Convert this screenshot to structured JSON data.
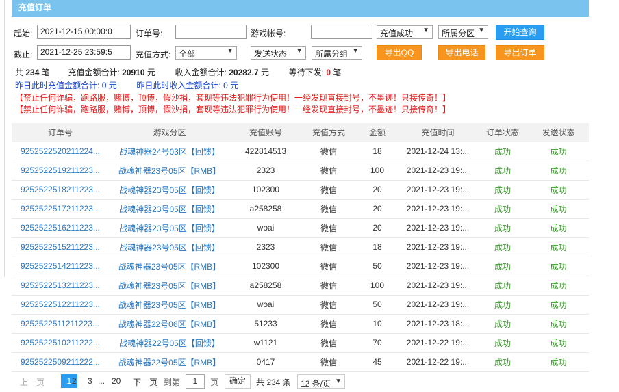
{
  "title": "充值订单",
  "filters": {
    "start_label": "起始:",
    "start_value": "2021-12-15 00:00:0",
    "order_label": "订单号:",
    "order_value": "",
    "account_label": "游戏帐号:",
    "account_value": "",
    "status_select": "充值成功",
    "zone_select": "所属分区",
    "query_btn": "开始查询",
    "end_label": "截止:",
    "end_value": "2021-12-25 23:59:5",
    "method_label": "充值方式:",
    "method_select": "全部",
    "send_select": "发送状态",
    "group_select": "所属分组",
    "export_qq": "导出QQ",
    "export_phone": "导出电话",
    "export_order": "导出订单"
  },
  "summary": {
    "total_prefix": "共",
    "total_count": "234",
    "total_suffix": "笔",
    "recharge_label": "充值金额合计:",
    "recharge_value": "20910",
    "recharge_unit": "元",
    "income_label": "收入金额合计:",
    "income_value": "20282.7",
    "income_unit": "元",
    "pending_label": "等待下发:",
    "pending_value": "0",
    "pending_unit": "笔",
    "yest_recharge_label": "昨日此时充值金额合计:",
    "yest_recharge_value": "0 元",
    "yest_income_label": "昨日此时收入金额合计:",
    "yest_income_value": "0 元"
  },
  "warnings": [
    "【禁止任何诈骗，跑路服，赌博，顶愽，假沙捐，套现等违法犯罪行为使用！一经发现直接封号，不墨迹！只接传奇！】",
    "【禁止任何诈骗，跑路服，赌博，顶愽，假沙捐，套现等违法犯罪行为使用！一经发现直接封号，不墨迹！只接传奇！】"
  ],
  "table": {
    "headers": [
      "订单号",
      "游戏分区",
      "充值账号",
      "充值方式",
      "金额",
      "充值时间",
      "订单状态",
      "发送状态"
    ],
    "rows": [
      {
        "order": "9252522520211224...",
        "zone": "战魂神器24号03区【回馈】",
        "account": "422814513",
        "method": "微信",
        "amount": "18",
        "time": "2021-12-24 13:...",
        "status": "成功",
        "send": "成功"
      },
      {
        "order": "9252522519211223...",
        "zone": "战魂神器23号05区【RMB】",
        "account": "2323",
        "method": "微信",
        "amount": "100",
        "time": "2021-12-23 19:...",
        "status": "成功",
        "send": "成功"
      },
      {
        "order": "9252522518211223...",
        "zone": "战魂神器23号05区【回馈】",
        "account": "102300",
        "method": "微信",
        "amount": "20",
        "time": "2021-12-23 19:...",
        "status": "成功",
        "send": "成功"
      },
      {
        "order": "9252522517211223...",
        "zone": "战魂神器23号05区【回馈】",
        "account": "a258258",
        "method": "微信",
        "amount": "20",
        "time": "2021-12-23 19:...",
        "status": "成功",
        "send": "成功"
      },
      {
        "order": "9252522516211223...",
        "zone": "战魂神器23号05区【回馈】",
        "account": "woai",
        "method": "微信",
        "amount": "20",
        "time": "2021-12-23 19:...",
        "status": "成功",
        "send": "成功"
      },
      {
        "order": "9252522515211223...",
        "zone": "战魂神器23号05区【回馈】",
        "account": "2323",
        "method": "微信",
        "amount": "18",
        "time": "2021-12-23 19:...",
        "status": "成功",
        "send": "成功"
      },
      {
        "order": "9252522514211223...",
        "zone": "战魂神器23号05区【RMB】",
        "account": "102300",
        "method": "微信",
        "amount": "50",
        "time": "2021-12-23 19:...",
        "status": "成功",
        "send": "成功"
      },
      {
        "order": "9252522513211223...",
        "zone": "战魂神器23号05区【RMB】",
        "account": "a258258",
        "method": "微信",
        "amount": "100",
        "time": "2021-12-23 19:...",
        "status": "成功",
        "send": "成功"
      },
      {
        "order": "9252522512211223...",
        "zone": "战魂神器23号05区【RMB】",
        "account": "woai",
        "method": "微信",
        "amount": "50",
        "time": "2021-12-23 19:...",
        "status": "成功",
        "send": "成功"
      },
      {
        "order": "9252522511211223...",
        "zone": "战魂神器22号06区【RMB】",
        "account": "51233",
        "method": "微信",
        "amount": "10",
        "time": "2021-12-23 18:...",
        "status": "成功",
        "send": "成功"
      },
      {
        "order": "9252522510211222...",
        "zone": "战魂神器22号05区【回馈】",
        "account": "w1121",
        "method": "微信",
        "amount": "70",
        "time": "2021-12-22 19:...",
        "status": "成功",
        "send": "成功"
      },
      {
        "order": "9252522509211222...",
        "zone": "战魂神器22号05区【RMB】",
        "account": "0417",
        "method": "微信",
        "amount": "45",
        "time": "2021-12-22 19:...",
        "status": "成功",
        "send": "成功"
      }
    ]
  },
  "pager": {
    "prev": "上一页",
    "page1": "1",
    "page2": "2",
    "page3": "3",
    "ellipsis": "...",
    "last": "20",
    "next": "下一页",
    "goto": "到第",
    "goto_value": "1",
    "page_unit": "页",
    "confirm": "确定",
    "total": "共 234 条",
    "per_page": "12 条/页"
  },
  "colors": {
    "header": "#79c3ee",
    "orange": "#f7951e",
    "blue": "#2b9df0",
    "link": "#2a78c2",
    "ok": "#3c9b2c",
    "warn": "#e01b1b"
  }
}
